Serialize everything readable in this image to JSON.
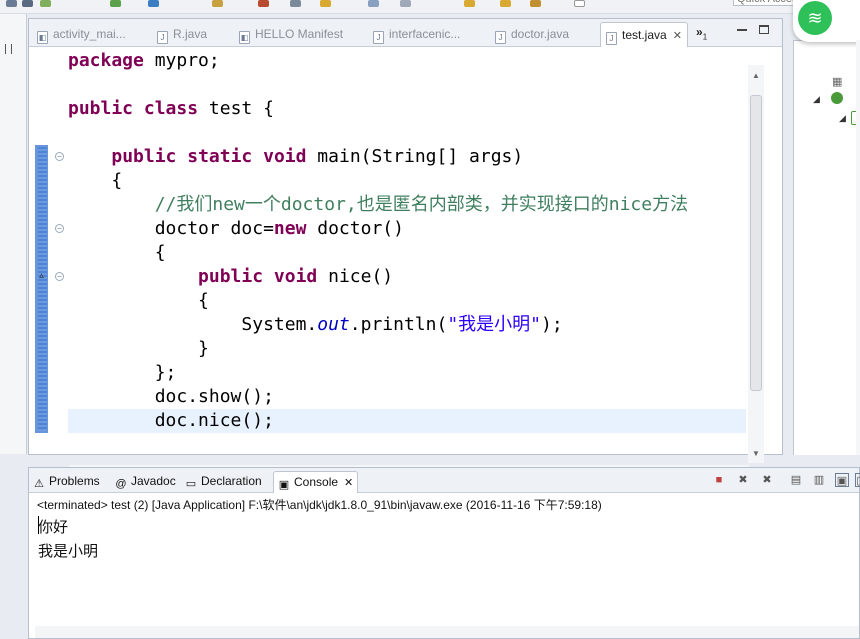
{
  "app": {
    "quick_access_placeholder": "Quick Access"
  },
  "editor": {
    "tabs": [
      {
        "label": "activity_mai...",
        "icon": "android-xml-icon",
        "active": false
      },
      {
        "label": "R.java",
        "icon": "java-file-icon",
        "active": false
      },
      {
        "label": "HELLO Manifest",
        "icon": "android-xml-icon",
        "active": false
      },
      {
        "label": "interfacenic...",
        "icon": "java-file-icon",
        "active": false
      },
      {
        "label": "doctor.java",
        "icon": "java-file-icon",
        "active": false
      },
      {
        "label": "test.java",
        "icon": "java-file-icon",
        "active": true
      }
    ],
    "overflow_label": "»",
    "overflow_count": "1",
    "close_glyph": "✕",
    "code_lines": [
      "package mypro;",
      "",
      "public class test {",
      "",
      "    public static void main(String[] args)",
      "    {",
      "        //我们new一个doctor,也是匿名内部类，并实现接口的nice方法",
      "        doctor doc=new doctor()",
      "        {",
      "            public void nice()",
      "            {",
      "                System.out.println(\"我是小明\");",
      "            }",
      "        };",
      "        doc.show();",
      "        doc.nice();"
    ],
    "current_line": 15
  },
  "console": {
    "tabs": [
      {
        "label": "Problems",
        "icon": "problems-icon",
        "active": false
      },
      {
        "label": "Javadoc",
        "icon": "javadoc-icon",
        "active": false
      },
      {
        "label": "Declaration",
        "icon": "declaration-icon",
        "active": false
      },
      {
        "label": "Console",
        "icon": "console-icon",
        "active": true
      }
    ],
    "status": "<terminated> test (2) [Java Application] F:\\软件\\an\\jdk\\jdk1.8.0_91\\bin\\javaw.exe (2016-11-16 下午7:59:18)",
    "output": [
      "你好",
      "我是小明"
    ]
  },
  "colors": {
    "keyword": "#7f0055",
    "comment": "#3f7f5f",
    "string": "#2a00ff",
    "field": "#0000c0",
    "wifi_badge": "#2fc159",
    "change_ruler": "#4f84d4"
  }
}
